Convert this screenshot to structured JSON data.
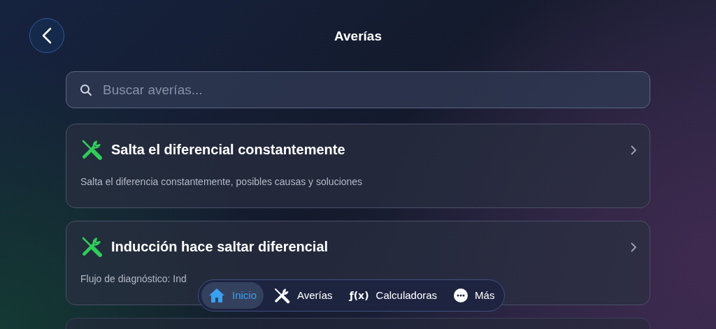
{
  "header": {
    "title": "Averías"
  },
  "search": {
    "placeholder": "Buscar averías..."
  },
  "cards": [
    {
      "title": "Salta el diferencial constantemente",
      "description": "Salta el diferencia constantemente, posibles causas y soluciones"
    },
    {
      "title": "Inducción hace saltar diferencial",
      "description": "Flujo de diagnóstico: Ind"
    }
  ],
  "nav": [
    {
      "kind": "home",
      "label": "Inicio",
      "selected": true
    },
    {
      "kind": "tools",
      "label": "Averías",
      "selected": false
    },
    {
      "kind": "function",
      "icon_text": "ƒ(x)",
      "label": "Calculadoras",
      "selected": false
    },
    {
      "kind": "more",
      "label": "Más",
      "selected": false
    }
  ]
}
